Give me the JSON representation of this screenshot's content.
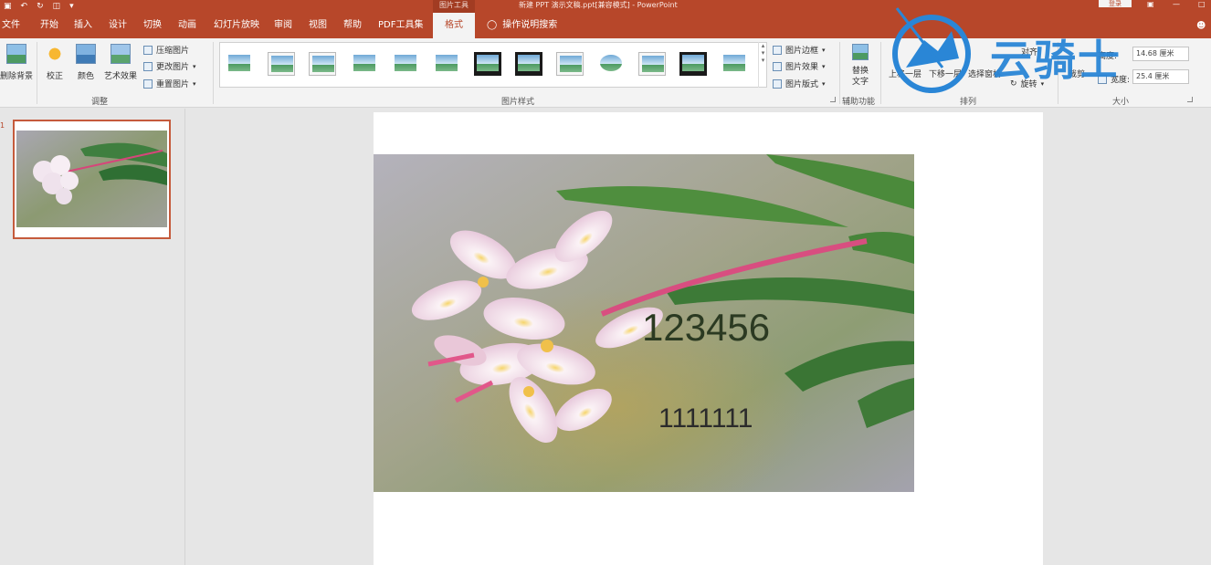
{
  "titlebar": {
    "context_label": "图片工具",
    "doc_title": "新建 PPT 演示文稿.ppt[兼容模式] - PowerPoint",
    "login": "登录"
  },
  "tabs": [
    "文件",
    "开始",
    "插入",
    "设计",
    "切换",
    "动画",
    "幻灯片放映",
    "审阅",
    "视图",
    "帮助",
    "PDF工具集",
    "格式"
  ],
  "active_tab": "格式",
  "tell_me": "操作说明搜索",
  "ribbon": {
    "adjust": {
      "remove_bg": "删除背景",
      "corrections": "校正",
      "color": "颜色",
      "artistic": "艺术效果",
      "compress": "压缩图片",
      "change": "更改图片",
      "reset": "重置图片",
      "label": "调整"
    },
    "styles": {
      "border": "图片边框",
      "effects": "图片效果",
      "layout": "图片版式",
      "label": "图片样式"
    },
    "accessibility": {
      "alt_text": "替换文字",
      "label": "辅助功能"
    },
    "arrange": {
      "bring_forward": "上移一层",
      "send_backward": "下移一层",
      "selection_pane": "选择窗格",
      "align": "对齐",
      "rotate": "旋转",
      "label": "排列"
    },
    "size": {
      "crop": "裁剪",
      "height_label": "高度:",
      "height_value": "14.68 厘米",
      "width_label": "宽度:",
      "width_value": "25.4 厘米",
      "label": "大小"
    }
  },
  "watermark": {
    "text": "云骑士"
  },
  "slide_panel": {
    "slide_number": "1"
  },
  "slide": {
    "text_large": "123456",
    "text_small": "1111111"
  }
}
